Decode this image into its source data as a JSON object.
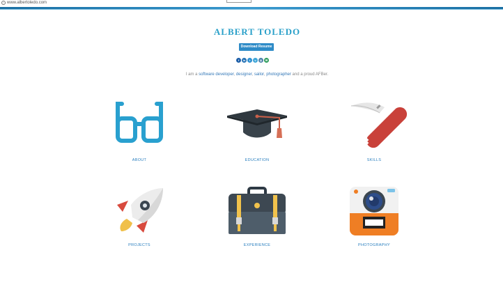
{
  "browser": {
    "url": "www.albertoledo.com"
  },
  "header": {
    "title": "ALBERT TOLEDO",
    "resume_button": "Download Resume"
  },
  "social": [
    {
      "icon": "facebook-icon",
      "color": "#1c5ea8",
      "glyph": "f"
    },
    {
      "icon": "linkedin-icon",
      "color": "#2673b6",
      "glyph": "in"
    },
    {
      "icon": "twitter-icon",
      "color": "#2e8fd0",
      "glyph": "t"
    },
    {
      "icon": "vimeo-icon",
      "color": "#3ea6d8",
      "glyph": "v"
    },
    {
      "icon": "instagram-icon",
      "color": "#4a7fa8",
      "glyph": "◎"
    },
    {
      "icon": "email-icon",
      "color": "#2f9c5c",
      "glyph": "✉"
    }
  ],
  "intro": {
    "prefix": "I am a ",
    "role1": "software developer",
    "sep1": ", ",
    "role2": "designer",
    "sep2": ", ",
    "role3": "sailor",
    "sep3": ", ",
    "role4": "photographer",
    "suffix": " and a proud AFBer."
  },
  "tiles": [
    {
      "label": "ABOUT",
      "icon": "glasses-icon"
    },
    {
      "label": "EDUCATION",
      "icon": "graduation-cap-icon"
    },
    {
      "label": "SKILLS",
      "icon": "pocket-knife-icon"
    },
    {
      "label": "PROJECTS",
      "icon": "rocket-icon"
    },
    {
      "label": "EXPERIENCE",
      "icon": "briefcase-icon"
    },
    {
      "label": "PHOTOGRAPHY",
      "icon": "camera-icon"
    }
  ]
}
